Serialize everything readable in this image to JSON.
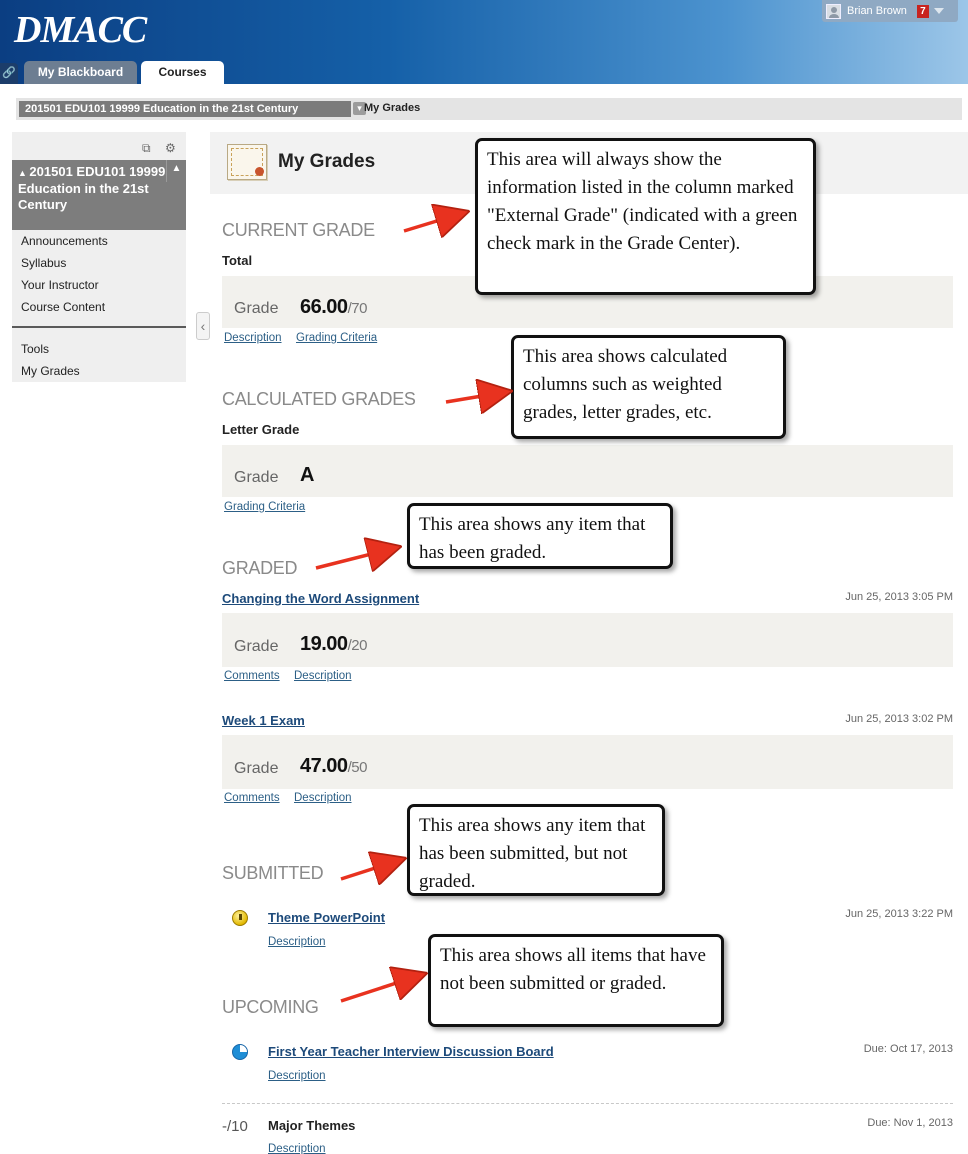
{
  "header": {
    "logo": "DMACC",
    "user_name": "Brian Brown",
    "notification_count": "7",
    "tabs": [
      {
        "label": "My Blackboard"
      },
      {
        "label": "Courses"
      }
    ]
  },
  "breadcrumb": {
    "course": "201501 EDU101 19999 Education in the 21st Century",
    "current": "My Grades"
  },
  "sidebar": {
    "course_title": "201501 EDU101 19999 Education in the 21st Century",
    "items": [
      {
        "label": "Announcements"
      },
      {
        "label": "Syllabus"
      },
      {
        "label": "Your Instructor"
      },
      {
        "label": "Course Content"
      },
      {
        "label": "Tools"
      },
      {
        "label": "My Grades"
      }
    ]
  },
  "page": {
    "title": "My Grades"
  },
  "current_grade": {
    "heading": "CURRENT GRADE",
    "label": "Total",
    "grade_word": "Grade",
    "value": "66.00",
    "possible": "/70",
    "links": [
      "Description",
      "Grading Criteria"
    ]
  },
  "calculated_grades": {
    "heading": "CALCULATED GRADES",
    "label": "Letter Grade",
    "grade_word": "Grade",
    "value": "A",
    "links": [
      "Grading Criteria"
    ]
  },
  "graded": {
    "heading": "GRADED",
    "items": [
      {
        "name": "Changing the Word Assignment",
        "date": "Jun 25, 2013 3:05 PM",
        "grade_word": "Grade",
        "value": "19.00",
        "possible": "/20",
        "links": [
          "Comments",
          "Description"
        ]
      },
      {
        "name": "Week 1 Exam",
        "date": "Jun 25, 2013 3:02 PM",
        "grade_word": "Grade",
        "value": "47.00",
        "possible": "/50",
        "links": [
          "Comments",
          "Description"
        ]
      }
    ]
  },
  "submitted": {
    "heading": "SUBMITTED",
    "items": [
      {
        "name": "Theme PowerPoint",
        "date": "Jun 25, 2013 3:22 PM",
        "link": "Description"
      }
    ]
  },
  "upcoming": {
    "heading": "UPCOMING",
    "items": [
      {
        "name": "First Year Teacher Interview Discussion Board",
        "date": "Due: Oct 17, 2013",
        "link": "Description"
      },
      {
        "score": "-/10",
        "name": "Major Themes",
        "date": "Due: Nov 1, 2013",
        "link": "Description"
      }
    ]
  },
  "callouts": {
    "current": "This area will always show the information listed in the column marked \"External Grade\" (indicated with a green check mark in the Grade Center).",
    "calculated": "This area shows calculated columns such as weighted grades, letter grades, etc.",
    "graded": "This area shows any item that has been graded.",
    "submitted": "This area shows any item that has been submitted, but not graded.",
    "upcoming": "This area shows all items that have not been submitted or graded."
  },
  "colors": {
    "header_start": "#0b3e82",
    "header_end": "#9cc6e8",
    "link": "#2c5f86",
    "arrow": "#e8321f",
    "grade_box": "#f2f1ed"
  },
  "icons": [
    "link-icon",
    "gear-icon",
    "window-icon",
    "chevron-up-icon",
    "chevron-left-icon",
    "certificate-icon",
    "exclamation-icon",
    "clock-icon",
    "caret-down-icon"
  ]
}
